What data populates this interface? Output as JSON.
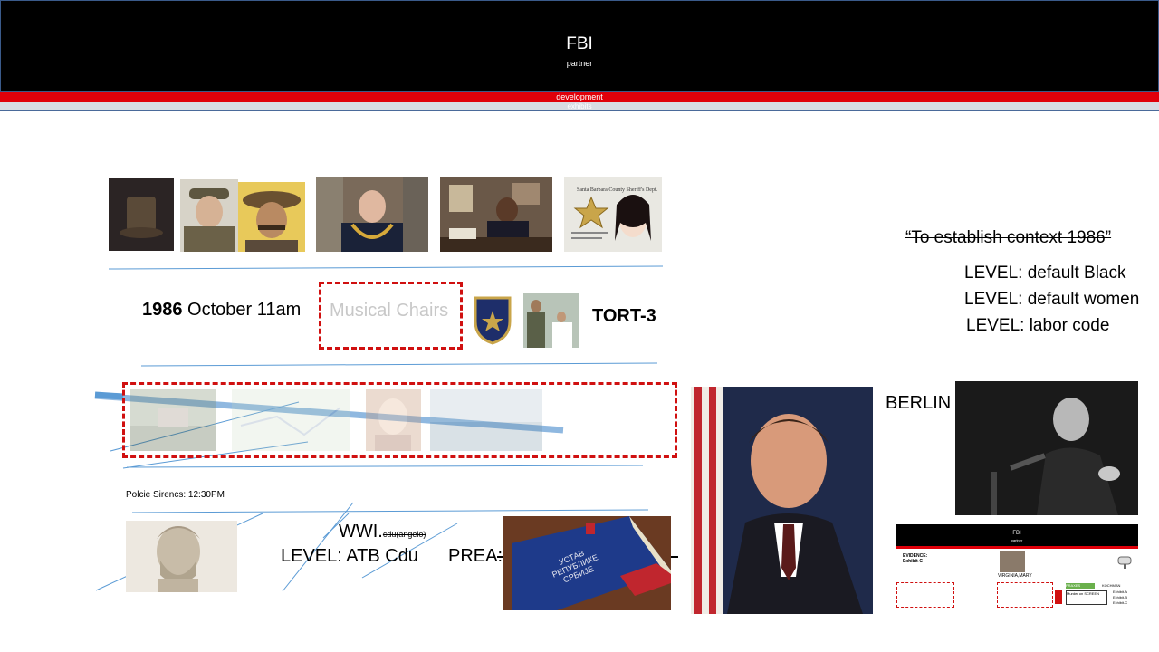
{
  "header": {
    "title": "FBI",
    "subtitle": "partner",
    "band_red_label": "development",
    "band_gray_label": "exhibits"
  },
  "quote": "“To establish context 1986”",
  "levels": [
    "LEVEL: default Black",
    "LEVEL: default women",
    "LEVEL: labor code"
  ],
  "date_line": {
    "year": "1986",
    "rest": " October 11am"
  },
  "musical_chairs": "Musical Chairs",
  "tort": "TORT-3",
  "berlin": "BERLIN",
  "police_sirens": "Polcie Sirencs: 12:30PM",
  "wwi": {
    "main": "WWI.",
    "small": "cdu(angelo)"
  },
  "atb": "LEVEL: ATB Cdu",
  "prea": "PREA:",
  "book_title": "УСТАВ РЕПУБЛИКЕ СРБИЈЕ",
  "badge_text": "FOSTER CITY POLICE",
  "card_header": "Santa Barbara County Sheriff's Dept.",
  "thumb": {
    "title": "FBI",
    "subtitle": "partner",
    "evidence": "EVIDENCE:",
    "exhibit": "Exhibit-C",
    "name": "VIRGINIA,MARY",
    "tag": "PRAXES",
    "murder": "Murder on SCREEN",
    "kochman": "KOCHMAN",
    "exhibits": [
      "Exhibit-A",
      "Exhibit-B",
      "Exhibit-C"
    ]
  },
  "colors": {
    "header_bg": "#000000",
    "band_red": "#e0000a",
    "band_gray": "#d8dbe3",
    "line_blue": "#5b9bd5",
    "dash_red": "#d01010"
  }
}
